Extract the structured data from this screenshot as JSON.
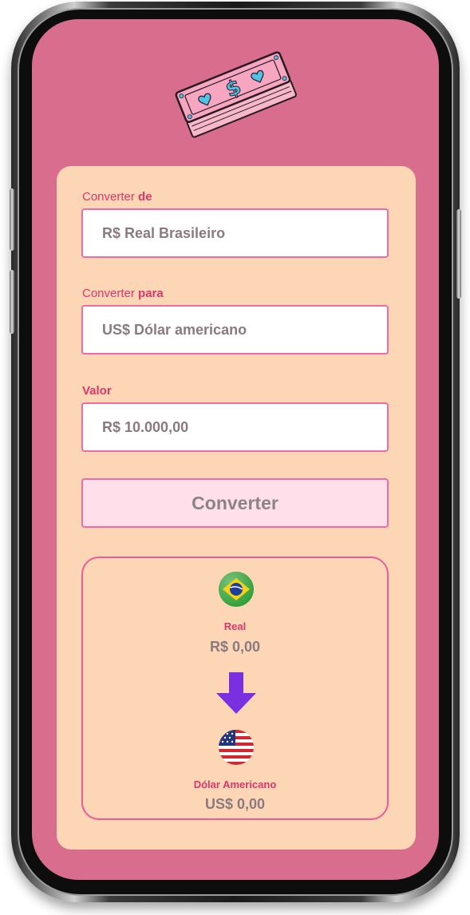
{
  "form": {
    "from_label_prefix": "Converter ",
    "from_label_bold": "de",
    "from_value": "R$ Real Brasileiro",
    "to_label_prefix": "Converter ",
    "to_label_bold": "para",
    "to_value": "US$ Dólar americano",
    "amount_label": "Valor",
    "amount_value": "R$ 10.000,00",
    "convert_button": "Converter"
  },
  "result": {
    "source_name": "Real",
    "source_value": "R$ 0,00",
    "source_flag": "brazil-flag",
    "target_name": "Dólar Americano",
    "target_value": "US$ 0,00",
    "target_flag": "usa-flag",
    "arrow_icon": "arrow-down-icon"
  },
  "colors": {
    "screen_bg": "#d96d8e",
    "card_bg": "#fdd7b5",
    "accent": "#e0356a",
    "field_border": "#f06aa5",
    "arrow": "#7a2fe0"
  }
}
